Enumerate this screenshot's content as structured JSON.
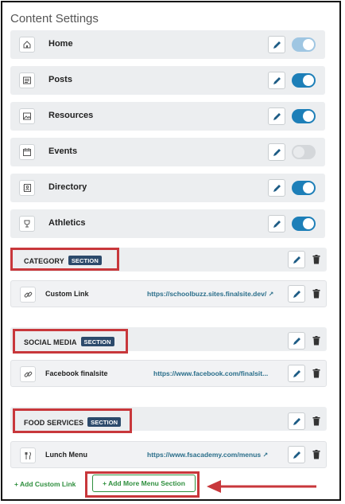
{
  "page": {
    "title": "Content Settings"
  },
  "menu_items": [
    {
      "label": "Home",
      "icon": "home-icon",
      "toggle": "light"
    },
    {
      "label": "Posts",
      "icon": "posts-icon",
      "toggle": "on"
    },
    {
      "label": "Resources",
      "icon": "image-icon",
      "toggle": "on"
    },
    {
      "label": "Events",
      "icon": "calendar-icon",
      "toggle": "off"
    },
    {
      "label": "Directory",
      "icon": "directory-icon",
      "toggle": "on"
    },
    {
      "label": "Athletics",
      "icon": "trophy-icon",
      "toggle": "on"
    }
  ],
  "sections": [
    {
      "name": "CATEGORY",
      "badge": "SECTION",
      "link": {
        "label": "Custom Link",
        "icon": "link-icon",
        "url": "https://schoolbuzz.sites.finalsite.dev/",
        "external": true
      }
    },
    {
      "name": "SOCIAL MEDIA",
      "badge": "SECTION",
      "link": {
        "label": "Facebook finalsite",
        "icon": "link-icon",
        "url": "https://www.facebook.com/finalsit...",
        "external": false
      }
    },
    {
      "name": "FOOD SERVICES",
      "badge": "SECTION",
      "link": {
        "label": "Lunch Menu",
        "icon": "utensils-icon",
        "url": "https://www.fsacademy.com/menus",
        "external": true
      }
    }
  ],
  "footer": {
    "add_custom_link": "+ Add Custom Link",
    "add_more_menu_section": "+ Add More Menu Section"
  },
  "colors": {
    "toggle_on": "#1d7fb8",
    "highlight_red": "#c8373b",
    "add_green": "#2f8f3e",
    "badge_navy": "#2c4a6b",
    "url_teal": "#2a6e8a"
  }
}
